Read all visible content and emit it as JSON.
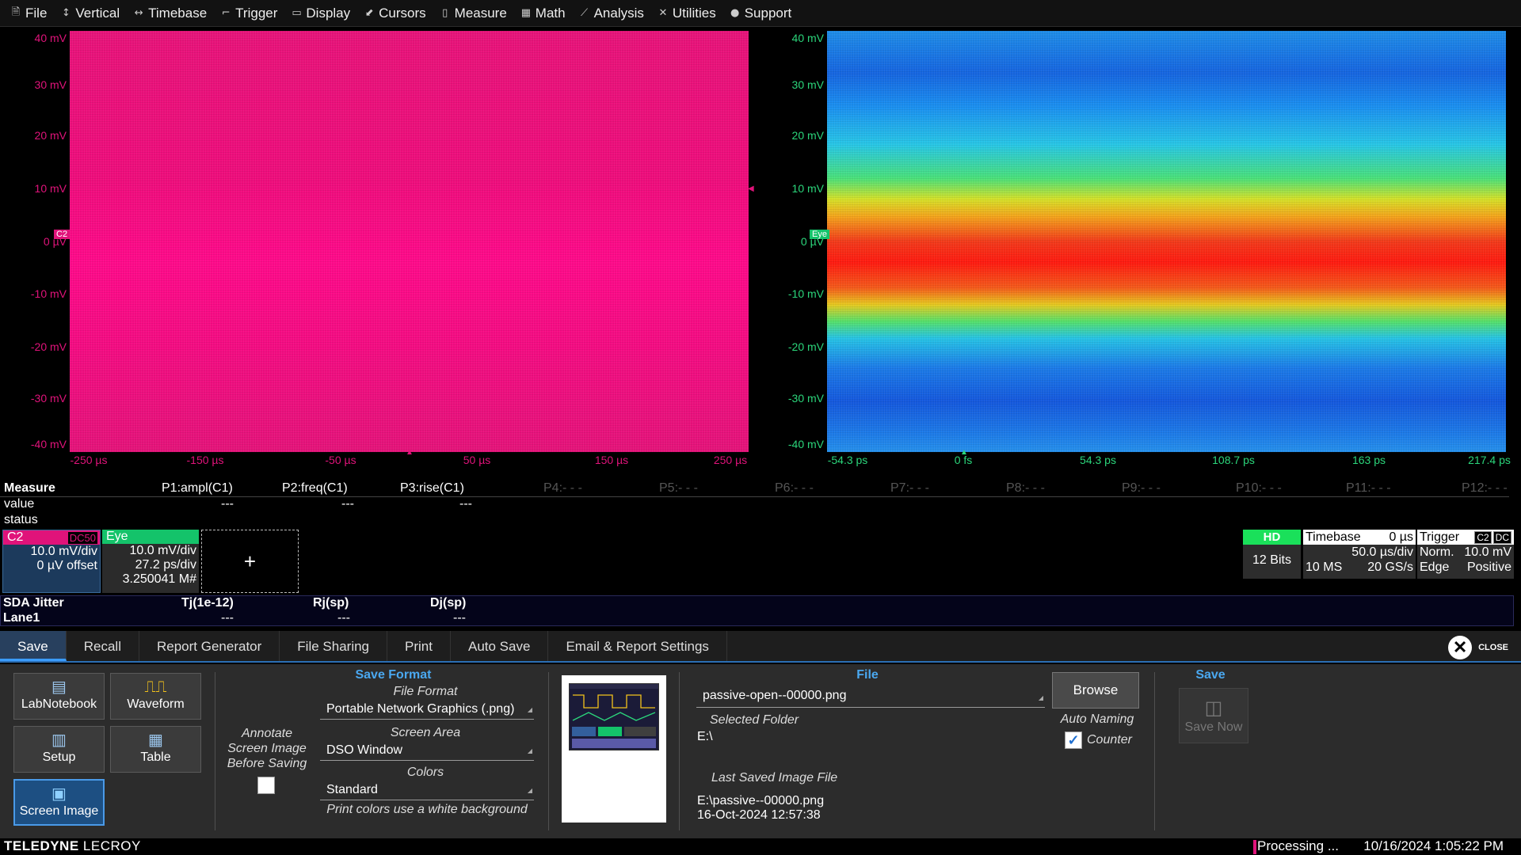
{
  "menu": {
    "items": [
      {
        "label": "File",
        "icon": "file-icon"
      },
      {
        "label": "Vertical",
        "icon": "vertical-icon"
      },
      {
        "label": "Timebase",
        "icon": "timebase-icon"
      },
      {
        "label": "Trigger",
        "icon": "trigger-icon"
      },
      {
        "label": "Display",
        "icon": "display-icon"
      },
      {
        "label": "Cursors",
        "icon": "cursors-icon"
      },
      {
        "label": "Measure",
        "icon": "measure-icon"
      },
      {
        "label": "Math",
        "icon": "math-icon"
      },
      {
        "label": "Analysis",
        "icon": "analysis-icon"
      },
      {
        "label": "Utilities",
        "icon": "utilities-icon"
      },
      {
        "label": "Support",
        "icon": "support-icon"
      }
    ]
  },
  "grid_left": {
    "color": "#e0137a",
    "y_labels": [
      "40 mV",
      "30 mV",
      "20 mV",
      "10 mV",
      "0 µV",
      "-10 mV",
      "-20 mV",
      "-30 mV",
      "-40 mV"
    ],
    "x_labels": [
      "-250 µs",
      "-150 µs",
      "-50 µs",
      "50 µs",
      "150 µs",
      "250 µs"
    ],
    "channel_tag": "C2"
  },
  "grid_right": {
    "color": "#2bd67b",
    "y_labels": [
      "40 mV",
      "30 mV",
      "20 mV",
      "10 mV",
      "0 µV",
      "-10 mV",
      "-20 mV",
      "-30 mV",
      "-40 mV"
    ],
    "x_labels": [
      "-54.3 ps",
      "0 fs",
      "54.3 ps",
      "108.7 ps",
      "163 ps",
      "217.4 ps"
    ],
    "channel_tag": "Eye"
  },
  "measure": {
    "title": "Measure",
    "row_labels": [
      "value",
      "status"
    ],
    "params": [
      {
        "name": "P1:ampl(C1)",
        "value": "---"
      },
      {
        "name": "P2:freq(C1)",
        "value": "---"
      },
      {
        "name": "P3:rise(C1)",
        "value": "---"
      },
      {
        "name": "P4:- - -",
        "value": ""
      },
      {
        "name": "P5:- - -",
        "value": ""
      },
      {
        "name": "P6:- - -",
        "value": ""
      },
      {
        "name": "P7:- - -",
        "value": ""
      },
      {
        "name": "P8:- - -",
        "value": ""
      },
      {
        "name": "P9:- - -",
        "value": ""
      },
      {
        "name": "P10:- - -",
        "value": ""
      },
      {
        "name": "P11:- - -",
        "value": ""
      },
      {
        "name": "P12:- - -",
        "value": ""
      }
    ]
  },
  "c2_desc": {
    "name": "C2",
    "coupling": "DC50",
    "vdiv": "10.0 mV/div",
    "offset": "0 µV offset",
    "color": "#e0137a"
  },
  "eye_desc": {
    "name": "Eye",
    "vdiv": "10.0 mV/div",
    "tdiv": "27.2 ps/div",
    "count": "3.250041 M#",
    "color": "#14c36a"
  },
  "add_trace": "+",
  "hd": {
    "label": "HD",
    "bits": "12 Bits"
  },
  "timebase": {
    "title": "Timebase",
    "delay": "0 µs",
    "tdiv": "50.0 µs/div",
    "samples": "10 MS",
    "rate": "20 GS/s"
  },
  "trigger": {
    "title": "Trigger",
    "src": "C2",
    "coupling": "DC",
    "mode": "Norm.",
    "level": "10.0 mV",
    "type": "Edge",
    "slope": "Positive"
  },
  "sda": {
    "title": "SDA Jitter",
    "lane": "Lane1",
    "cols": [
      "Tj(1e-12)",
      "Rj(sp)",
      "Dj(sp)"
    ],
    "values": [
      "---",
      "---",
      "---"
    ]
  },
  "tabs": [
    "Save",
    "Recall",
    "Report Generator",
    "File Sharing",
    "Print",
    "Auto Save",
    "Email & Report Settings"
  ],
  "close_label": "CLOSE",
  "save_tiles": [
    "LabNotebook",
    "Waveform",
    "Setup",
    "Table",
    "Screen Image"
  ],
  "annotate": {
    "label": "Annotate Screen Image Before Saving",
    "checked": false
  },
  "save_format": {
    "title": "Save Format",
    "file_format_label": "File Format",
    "file_format": "Portable Network Graphics (.png)",
    "screen_area_label": "Screen Area",
    "screen_area": "DSO Window",
    "colors_label": "Colors",
    "colors": "Standard",
    "note": "Print colors use a white background"
  },
  "file": {
    "title": "File",
    "filename": "passive-open--00000.png",
    "selected_folder_label": "Selected Folder",
    "selected_folder": "E:\\",
    "browse": "Browse",
    "auto_naming": "Auto Naming",
    "counter_label": "Counter",
    "counter_checked": true,
    "last_saved_label": "Last Saved Image File",
    "last_saved_file": "E:\\passive--00000.png",
    "last_saved_time": "16-Oct-2024 12:57:38"
  },
  "save": {
    "title": "Save",
    "button": "Save Now"
  },
  "status": {
    "brand_bold": "TELEDYNE",
    "brand_light": " LECROY",
    "processing": "Processing ...",
    "datetime": "10/16/2024 1:05:22 PM"
  }
}
